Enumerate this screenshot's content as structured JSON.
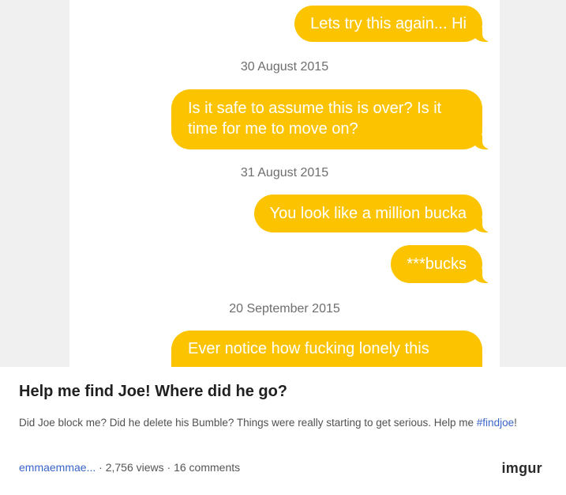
{
  "messages": [
    {
      "type": "bubble",
      "text": "Lets try this again... Hi"
    },
    {
      "type": "date",
      "text": "30 August 2015"
    },
    {
      "type": "bubble",
      "text": "Is it safe to assume this is over? Is it time for me to move on?"
    },
    {
      "type": "date",
      "text": "31 August 2015"
    },
    {
      "type": "bubble",
      "text": "You look like a million bucka"
    },
    {
      "type": "bubble",
      "text": "***bucks"
    },
    {
      "type": "date",
      "text": "20 September 2015"
    },
    {
      "type": "bubble",
      "text": "Ever notice how fucking lonely this"
    }
  ],
  "post": {
    "title": "Help me find Joe! Where did he go?",
    "description": "Did Joe block me? Did he delete his Bumble? Things were really starting to get serious. Help me ",
    "hashtag": "#findjoe",
    "description_end": "!",
    "author": "emmaemmae...",
    "sep1": " · ",
    "views": "2,756 views",
    "sep2": " · ",
    "comments": "16 comments",
    "brand": "imgur"
  },
  "colors": {
    "bubble": "#fcc400",
    "link": "#3a64c8"
  }
}
